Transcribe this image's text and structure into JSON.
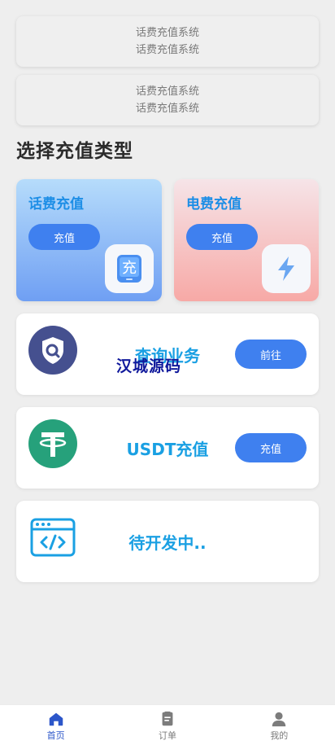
{
  "notices": [
    {
      "lines": [
        "话费充值系统",
        "话费充值系统"
      ]
    },
    {
      "lines": [
        "话费充值系统",
        "话费充值系统"
      ]
    }
  ],
  "section_title": "选择充值类型",
  "type_cards": [
    {
      "title": "话费充值",
      "button": "充值",
      "icon": "phone-charge-icon",
      "icon_glyph": "充"
    },
    {
      "title": "电费充值",
      "button": "充值",
      "icon": "lightning-icon"
    }
  ],
  "rows": [
    {
      "text": "查询业务",
      "button": "前往",
      "icon": "shield-search-icon"
    },
    {
      "text": "USDT充值",
      "button": "充值",
      "icon": "tether-icon"
    },
    {
      "text": "待开发中..",
      "icon": "code-window-icon"
    }
  ],
  "watermark": "汉城源码",
  "tabs": [
    {
      "label": "首页",
      "icon": "home-icon",
      "active": true
    },
    {
      "label": "订单",
      "icon": "order-icon",
      "active": false
    },
    {
      "label": "我的",
      "icon": "user-icon",
      "active": false
    }
  ],
  "colors": {
    "accent": "#3f80ef",
    "title_blue": "#1d8ee6",
    "row_text": "#1aa0e3",
    "tab_active": "#2c56c9",
    "watermark": "#111a9c"
  }
}
